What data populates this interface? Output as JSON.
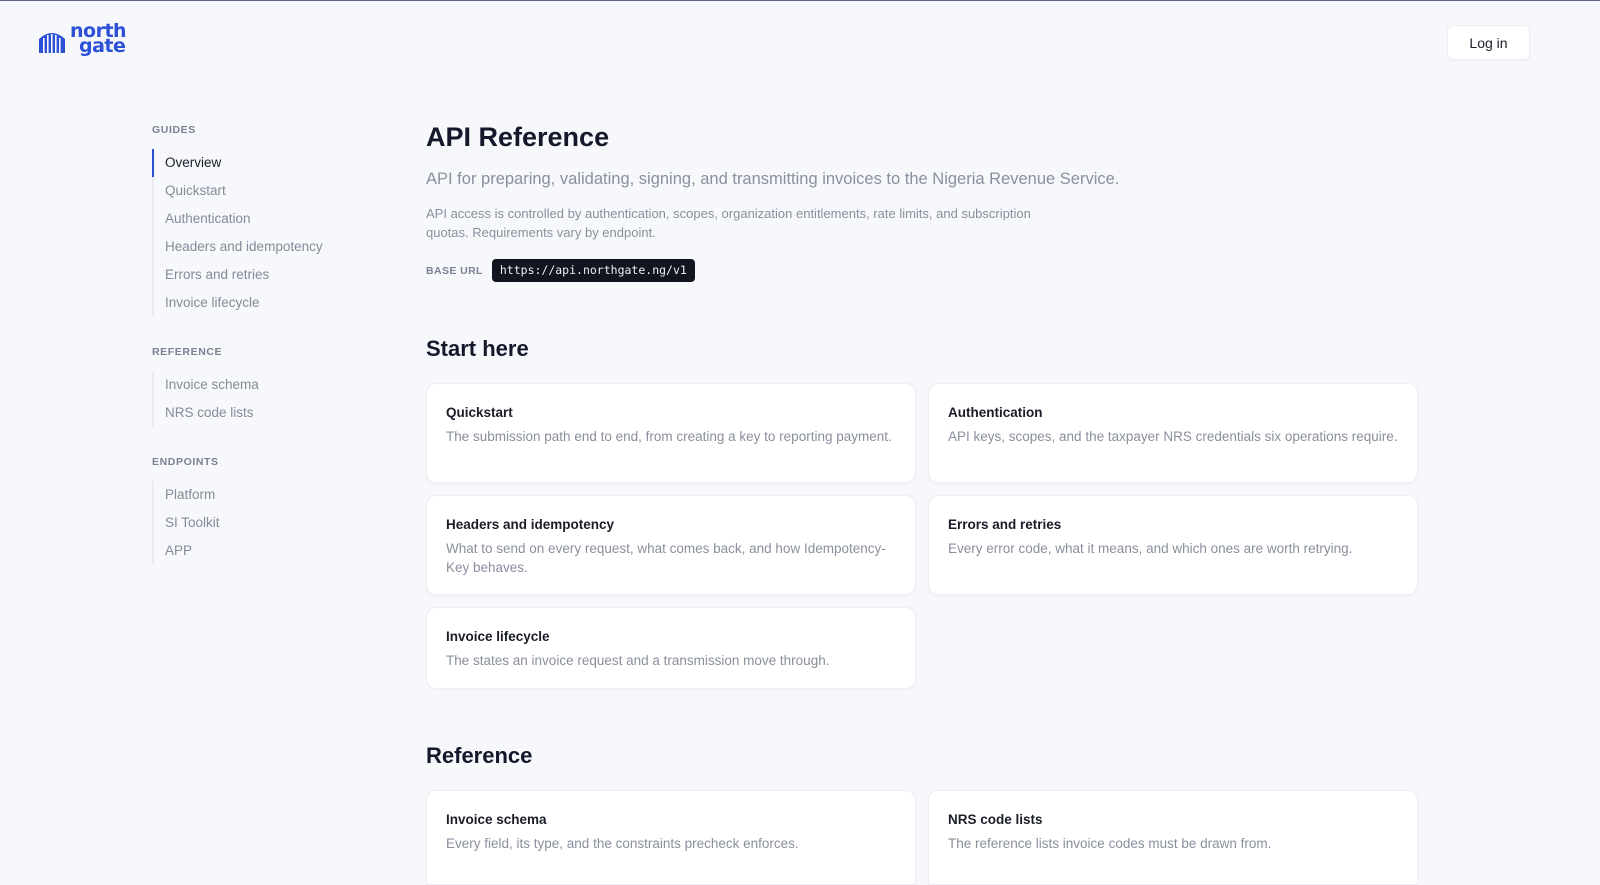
{
  "header": {
    "logo_line1": "north",
    "logo_line2": "gate",
    "login_label": "Log in",
    "brand_color": "#2c50d6"
  },
  "sidebar": {
    "guides_title": "GUIDES",
    "guides": [
      {
        "label": "Overview",
        "active": true
      },
      {
        "label": "Quickstart"
      },
      {
        "label": "Authentication"
      },
      {
        "label": "Headers and idempotency"
      },
      {
        "label": "Errors and retries"
      },
      {
        "label": "Invoice lifecycle"
      }
    ],
    "reference_title": "REFERENCE",
    "reference": [
      {
        "label": "Invoice schema"
      },
      {
        "label": "NRS code lists"
      }
    ],
    "endpoints_title": "ENDPOINTS",
    "endpoints": [
      {
        "label": "Platform"
      },
      {
        "label": "SI Toolkit"
      },
      {
        "label": "APP"
      }
    ]
  },
  "main": {
    "title": "API Reference",
    "lead": "API for preparing, validating, signing, and transmitting invoices to the Nigeria Revenue Service.",
    "description": "API access is controlled by authentication, scopes, organization entitlements, rate limits, and subscription quotas. Requirements vary by endpoint.",
    "base_url_label": "BASE URL",
    "base_url": "https://api.northgate.ng/v1",
    "start_here_title": "Start here",
    "start_cards": [
      {
        "title": "Quickstart",
        "desc": "The submission path end to end, from creating a key to reporting payment."
      },
      {
        "title": "Authentication",
        "desc": "API keys, scopes, and the taxpayer NRS credentials six operations require."
      },
      {
        "title": "Headers and idempotency",
        "desc": "What to send on every request, what comes back, and how Idempotency-Key behaves."
      },
      {
        "title": "Errors and retries",
        "desc": "Every error code, what it means, and which ones are worth retrying."
      },
      {
        "title": "Invoice lifecycle",
        "desc": "The states an invoice request and a transmission move through."
      }
    ],
    "reference_title": "Reference",
    "reference_cards": [
      {
        "title": "Invoice schema",
        "desc": "Every field, its type, and the constraints precheck enforces."
      },
      {
        "title": "NRS code lists",
        "desc": "The reference lists invoice codes must be drawn from."
      }
    ]
  }
}
